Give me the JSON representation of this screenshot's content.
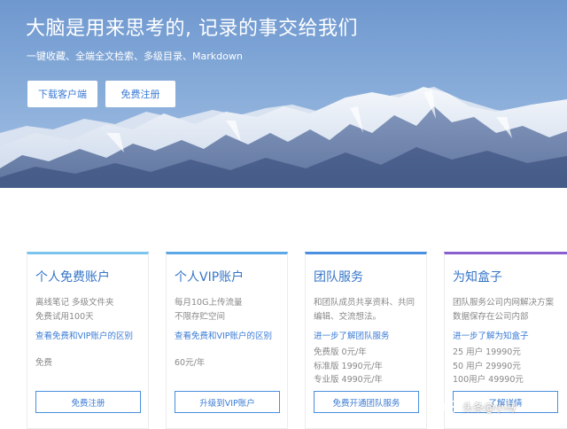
{
  "hero": {
    "title": "大脑是用来思考的, 记录的事交给我们",
    "subtitle": "一键收藏、全端全文检索、多级目录、Markdown",
    "download_label": "下载客户端",
    "register_label": "免费注册"
  },
  "cards": [
    {
      "title": "个人免费账户",
      "desc": [
        "离线笔记 多级文件夹",
        "免费试用100天"
      ],
      "link": "查看免费和VIP账户的区别",
      "price": "免费",
      "button": "免费注册",
      "accent": "#7cc4ee"
    },
    {
      "title": "个人VIP账户",
      "desc": [
        "每月10G上传流量",
        "不限存贮空间"
      ],
      "link": "查看免费和VIP账户的区别",
      "price": "60元/年",
      "button": "升级到VIP账户",
      "accent": "#5ba8e6"
    },
    {
      "title": "团队服务",
      "desc": [
        "和团队成员共享资料、共同",
        "编辑、交流想法。"
      ],
      "link": "进一步了解团队服务",
      "prices": [
        "免费版 0元/年",
        "标准版 1990元/年",
        "专业版 4990元/年"
      ],
      "button": "免费开通团队服务",
      "accent": "#4a8fe0"
    },
    {
      "title": "为知盒子",
      "desc": [
        "团队服务公司内网解决方案",
        "数据保存在公司内部"
      ],
      "link": "进一步了解为知盒子",
      "prices": [
        "25  用户 19990元",
        "50  用户 29990元",
        "100用户 49990元"
      ],
      "button": "了解详情",
      "accent": "#8a5fd0"
    }
  ],
  "watermark": {
    "text": "头条@小马"
  }
}
